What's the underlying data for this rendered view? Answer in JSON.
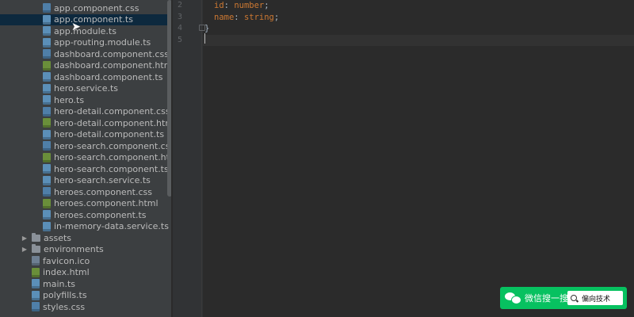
{
  "sidebar": {
    "files": [
      {
        "label": "app.component.css",
        "type": "css"
      },
      {
        "label": "app.component.ts",
        "type": "ts",
        "selected": true
      },
      {
        "label": "app.module.ts",
        "type": "ts"
      },
      {
        "label": "app-routing.module.ts",
        "type": "ts"
      },
      {
        "label": "dashboard.component.css",
        "type": "css"
      },
      {
        "label": "dashboard.component.html",
        "type": "html"
      },
      {
        "label": "dashboard.component.ts",
        "type": "ts"
      },
      {
        "label": "hero.service.ts",
        "type": "ts"
      },
      {
        "label": "hero.ts",
        "type": "ts"
      },
      {
        "label": "hero-detail.component.css",
        "type": "css"
      },
      {
        "label": "hero-detail.component.html",
        "type": "html"
      },
      {
        "label": "hero-detail.component.ts",
        "type": "ts"
      },
      {
        "label": "hero-search.component.css",
        "type": "css"
      },
      {
        "label": "hero-search.component.html",
        "type": "html"
      },
      {
        "label": "hero-search.component.ts",
        "type": "ts"
      },
      {
        "label": "hero-search.service.ts",
        "type": "ts"
      },
      {
        "label": "heroes.component.css",
        "type": "css"
      },
      {
        "label": "heroes.component.html",
        "type": "html"
      },
      {
        "label": "heroes.component.ts",
        "type": "ts"
      },
      {
        "label": "in-memory-data.service.ts",
        "type": "ts"
      }
    ],
    "folders": [
      {
        "label": "assets"
      },
      {
        "label": "environments"
      }
    ],
    "root_files": [
      {
        "label": "favicon.ico",
        "type": "ico"
      },
      {
        "label": "index.html",
        "type": "html"
      },
      {
        "label": "main.ts",
        "type": "ts"
      },
      {
        "label": "polyfills.ts",
        "type": "ts"
      },
      {
        "label": "styles.css",
        "type": "css"
      }
    ]
  },
  "editor": {
    "lines": [
      {
        "num": "2",
        "prop": "id",
        "sep": ": ",
        "type": "number",
        "end": ";"
      },
      {
        "num": "3",
        "prop": "name",
        "sep": ": ",
        "type": "string",
        "end": ";"
      },
      {
        "num": "4",
        "prop": "",
        "sep": "",
        "type": "",
        "end": "}"
      },
      {
        "num": "5",
        "prop": "",
        "sep": "",
        "type": "",
        "end": ""
      }
    ]
  },
  "overlay": {
    "brand": "微信搜一搜",
    "query": "偏向技术"
  },
  "colors": {
    "keyword": "#cc7832",
    "text": "#a9b7c6",
    "sidebar_bg": "#3c3f41",
    "editor_bg": "#2b2b2b",
    "selection": "#0d293e",
    "wechat_green": "#07c160"
  }
}
